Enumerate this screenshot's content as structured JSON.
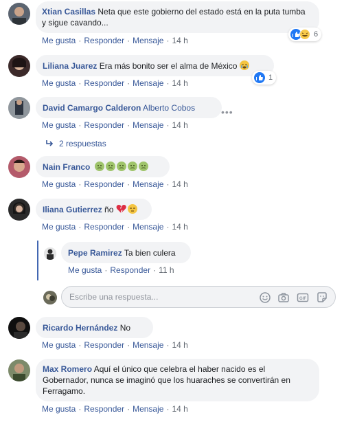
{
  "comments": [
    {
      "author": "Xtian Casillas",
      "text": "Neta que este gobierno del estado está en la puta tumba y sigue cavando...",
      "actions": {
        "like": "Me gusta",
        "reply": "Responder",
        "message": "Mensaje",
        "time": "14 h"
      },
      "reactions": {
        "icons": [
          "like-icon",
          "haha-icon"
        ],
        "count": "6"
      }
    },
    {
      "author": "Liliana Juarez",
      "text": "Era más bonito ser el alma de México",
      "actions": {
        "like": "Me gusta",
        "reply": "Responder",
        "message": "Mensaje",
        "time": "14 h"
      },
      "reactions": {
        "icons": [
          "like-icon"
        ],
        "count": "1"
      }
    },
    {
      "author": "David Camargo Calderon",
      "mention": "Alberto Cobos",
      "actions": {
        "like": "Me gusta",
        "reply": "Responder",
        "message": "Mensaje",
        "time": "14 h"
      },
      "replies_label": "2 respuestas"
    },
    {
      "author": "Nain Franco",
      "actions": {
        "like": "Me gusta",
        "reply": "Responder",
        "message": "Mensaje",
        "time": "14 h"
      }
    },
    {
      "author": "Iliana Gutierrez",
      "text": "ño",
      "actions": {
        "like": "Me gusta",
        "reply": "Responder",
        "message": "Mensaje",
        "time": "14 h"
      }
    },
    {
      "author": "Pepe Ramirez",
      "text": "Ta bien culera",
      "actions": {
        "like": "Me gusta",
        "reply": "Responder",
        "time": "11 h"
      }
    },
    {
      "author": "Ricardo Hernández",
      "text": "No",
      "actions": {
        "like": "Me gusta",
        "reply": "Responder",
        "message": "Mensaje",
        "time": "14 h"
      }
    },
    {
      "author": "Max Romero",
      "text": "Aquí el único que celebra el haber nacido es el Gobernador, nunca se imaginó que los huaraches se convertirán en Ferragamo.",
      "actions": {
        "like": "Me gusta",
        "reply": "Responder",
        "message": "Mensaje",
        "time": "14 h"
      }
    }
  ],
  "reply_box": {
    "placeholder": "Escribe una respuesta...",
    "icons": [
      "emoji-icon",
      "camera-icon",
      "gif-icon",
      "sticker-icon"
    ]
  },
  "colors": {
    "link": "#385898",
    "bubble": "#f2f3f5",
    "meta": "#606770",
    "like_blue": "#2078f4",
    "thread_line": "#4267b2"
  }
}
